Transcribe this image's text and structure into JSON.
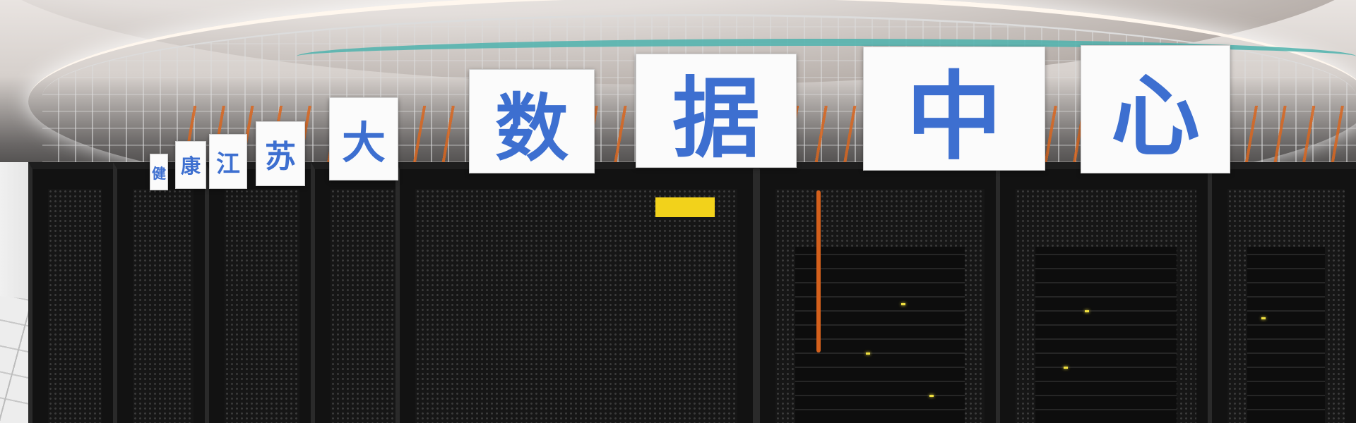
{
  "signs": [
    {
      "char": "健"
    },
    {
      "char": "康"
    },
    {
      "char": "江"
    },
    {
      "char": "苏"
    },
    {
      "char": "大"
    },
    {
      "char": "数"
    },
    {
      "char": "据"
    },
    {
      "char": "中"
    },
    {
      "char": "心"
    }
  ],
  "warning_label": {
    "text": ""
  },
  "colors": {
    "sign_text": "#3d6fd0",
    "cable_orange": "#d9661f",
    "fiber_aqua": "#4fb3ae",
    "rack_black": "#121212",
    "warning_yellow": "#f2d21b"
  }
}
